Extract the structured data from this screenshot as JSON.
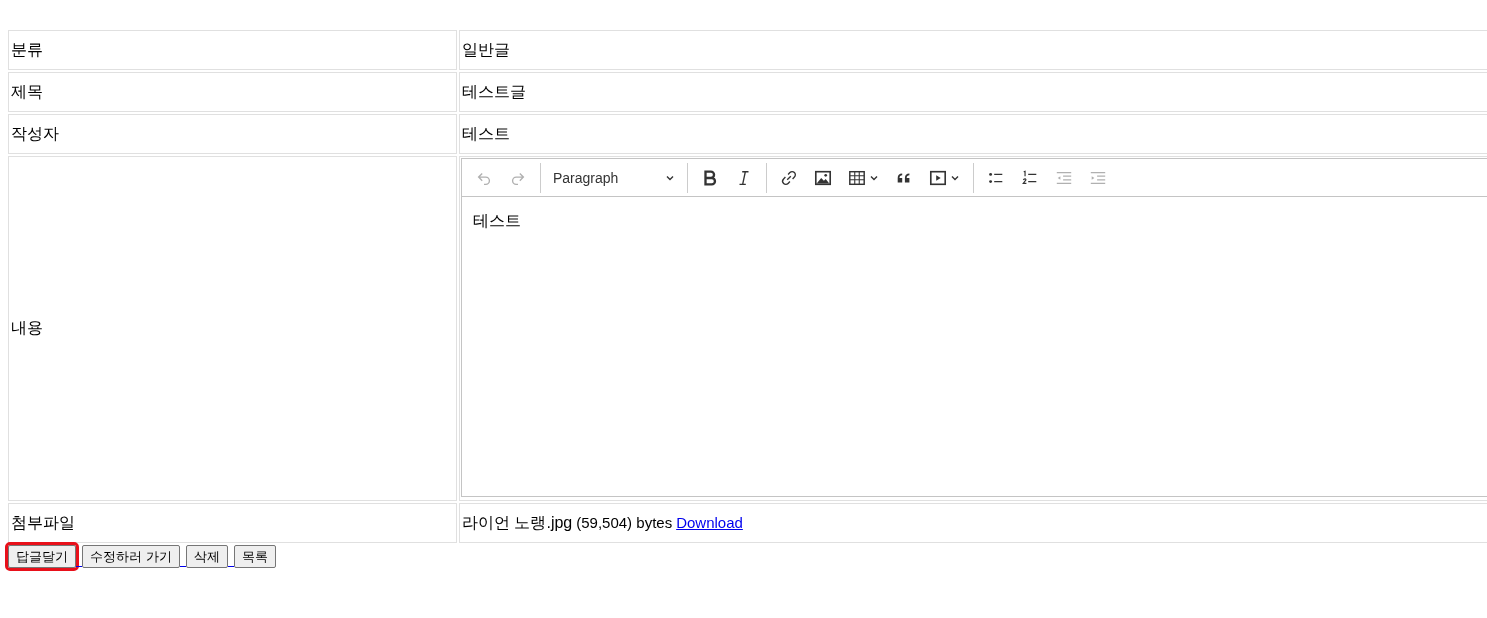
{
  "fields": [
    {
      "label": "분류",
      "value": "일반글"
    },
    {
      "label": "제목",
      "value": "테스트글"
    },
    {
      "label": "작성자",
      "value": "테스트"
    }
  ],
  "content": {
    "label": "내용",
    "toolbar": [
      {
        "kind": "undo",
        "disabled": true
      },
      {
        "kind": "redo",
        "disabled": true
      },
      {
        "kind": "separator"
      },
      {
        "kind": "heading",
        "label": "Paragraph"
      },
      {
        "kind": "separator"
      },
      {
        "kind": "bold",
        "disabled": false
      },
      {
        "kind": "italic",
        "disabled": false
      },
      {
        "kind": "separator"
      },
      {
        "kind": "link",
        "disabled": false
      },
      {
        "kind": "image",
        "disabled": false
      },
      {
        "kind": "table",
        "disabled": false
      },
      {
        "kind": "quote",
        "disabled": false
      },
      {
        "kind": "media",
        "disabled": false
      },
      {
        "kind": "separator"
      },
      {
        "kind": "bulleted-list",
        "disabled": false
      },
      {
        "kind": "numbered-list",
        "disabled": false
      },
      {
        "kind": "outdent",
        "disabled": true
      },
      {
        "kind": "indent",
        "disabled": true
      }
    ],
    "body": "테스트"
  },
  "attachment": {
    "label": "첨부파일",
    "file_name": "라이언 노랭.jpg",
    "size": "(59,504) bytes",
    "link": "Download"
  },
  "buttons": [
    {
      "label": "답글달기",
      "focused": true
    },
    {
      "label": "수정하러 가기",
      "focused": false
    },
    {
      "label": "삭제",
      "focused": false
    },
    {
      "label": "목록",
      "focused": false
    }
  ]
}
